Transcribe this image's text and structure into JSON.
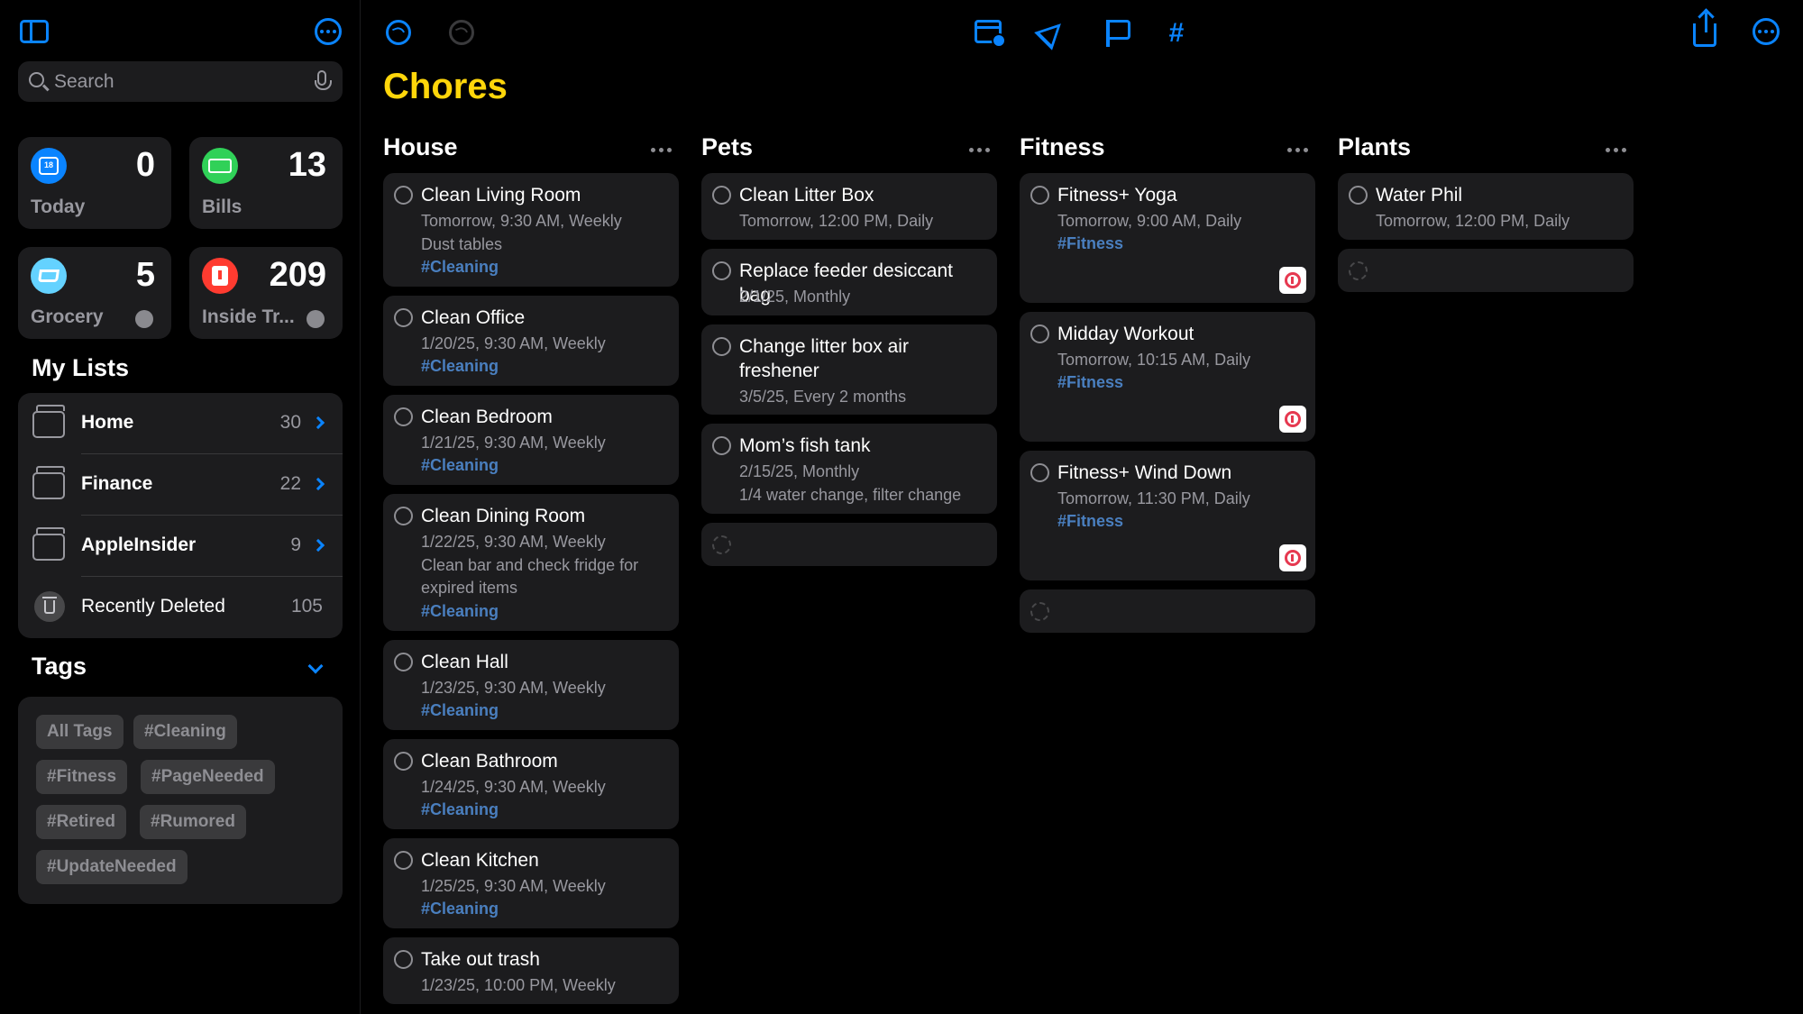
{
  "sidebar": {
    "search_placeholder": "Search",
    "smart_lists": [
      {
        "label": "Today",
        "count": "0",
        "color": "#0a84ff",
        "icon": "calendar-icon",
        "glyph": "18"
      },
      {
        "label": "Bills",
        "count": "13",
        "color": "#30d158",
        "icon": "money-icon"
      },
      {
        "label": "Grocery",
        "count": "5",
        "color": "#64d2ff",
        "icon": "cart-icon"
      },
      {
        "label": "Inside Tr...",
        "count": "209",
        "color": "#ff3b30",
        "icon": "document-icon"
      }
    ],
    "my_lists_title": "My Lists",
    "lists": [
      {
        "name": "Home",
        "count": "30"
      },
      {
        "name": "Finance",
        "count": "22"
      },
      {
        "name": "AppleInsider",
        "count": "9"
      },
      {
        "name": "Recently Deleted",
        "count": "105"
      }
    ],
    "tags_title": "Tags",
    "tags": [
      "All Tags",
      "#Cleaning",
      "#Fitness",
      "#PageNeeded",
      "#Retired",
      "#Rumored",
      "#UpdateNeeded"
    ]
  },
  "main": {
    "title": "Chores",
    "accent": "#ffd60a",
    "columns": [
      {
        "title": "House",
        "cards": [
          {
            "title": "Clean Living Room",
            "lines": [
              "Tomorrow, 9:30 AM, Weekly",
              "Dust tables"
            ],
            "tag": "#Cleaning"
          },
          {
            "title": "Clean Office",
            "lines": [
              "1/20/25, 9:30 AM, Weekly"
            ],
            "tag": "#Cleaning"
          },
          {
            "title": "Clean Bedroom",
            "lines": [
              "1/21/25, 9:30 AM, Weekly"
            ],
            "tag": "#Cleaning"
          },
          {
            "title": "Clean Dining Room",
            "lines": [
              "1/22/25, 9:30 AM, Weekly",
              "Clean bar and check fridge for",
              "expired items"
            ],
            "tag": "#Cleaning"
          },
          {
            "title": "Clean Hall",
            "lines": [
              "1/23/25, 9:30 AM, Weekly"
            ],
            "tag": "#Cleaning"
          },
          {
            "title": "Clean Bathroom",
            "lines": [
              "1/24/25, 9:30 AM, Weekly"
            ],
            "tag": "#Cleaning"
          },
          {
            "title": "Clean Kitchen",
            "lines": [
              "1/25/25, 9:30 AM, Weekly"
            ],
            "tag": "#Cleaning"
          },
          {
            "title": "Take out trash",
            "lines": [
              "1/23/25, 10:00 PM, Weekly"
            ],
            "tag": ""
          }
        ]
      },
      {
        "title": "Pets",
        "cards": [
          {
            "title": "Clean Litter Box",
            "lines": [
              "Tomorrow, 12:00 PM, Daily"
            ],
            "tag": ""
          },
          {
            "title": "Replace feeder desiccant bag",
            "lines": [
              "2/1/25, Monthly"
            ],
            "tag": ""
          },
          {
            "title": "Change litter box air freshener",
            "lines": [
              "3/5/25, Every 2 months"
            ],
            "tag": ""
          },
          {
            "title": "Mom’s fish tank",
            "lines": [
              "2/15/25, Monthly",
              "1/4 water change, filter change"
            ],
            "tag": ""
          }
        ]
      },
      {
        "title": "Fitness",
        "cards": [
          {
            "title": "Fitness+ Yoga",
            "lines": [
              "Tomorrow, 9:00 AM, Daily"
            ],
            "tag": "#Fitness"
          },
          {
            "title": "Midday Workout",
            "lines": [
              "Tomorrow, 10:15 AM, Daily"
            ],
            "tag": "#Fitness"
          },
          {
            "title": "Fitness+ Wind Down",
            "lines": [
              "Tomorrow, 11:30 PM, Daily"
            ],
            "tag": "#Fitness"
          }
        ]
      },
      {
        "title": "Plants",
        "cards": [
          {
            "title": "Water Phil",
            "lines": [
              "Tomorrow, 12:00 PM, Daily"
            ],
            "tag": ""
          }
        ]
      }
    ]
  }
}
